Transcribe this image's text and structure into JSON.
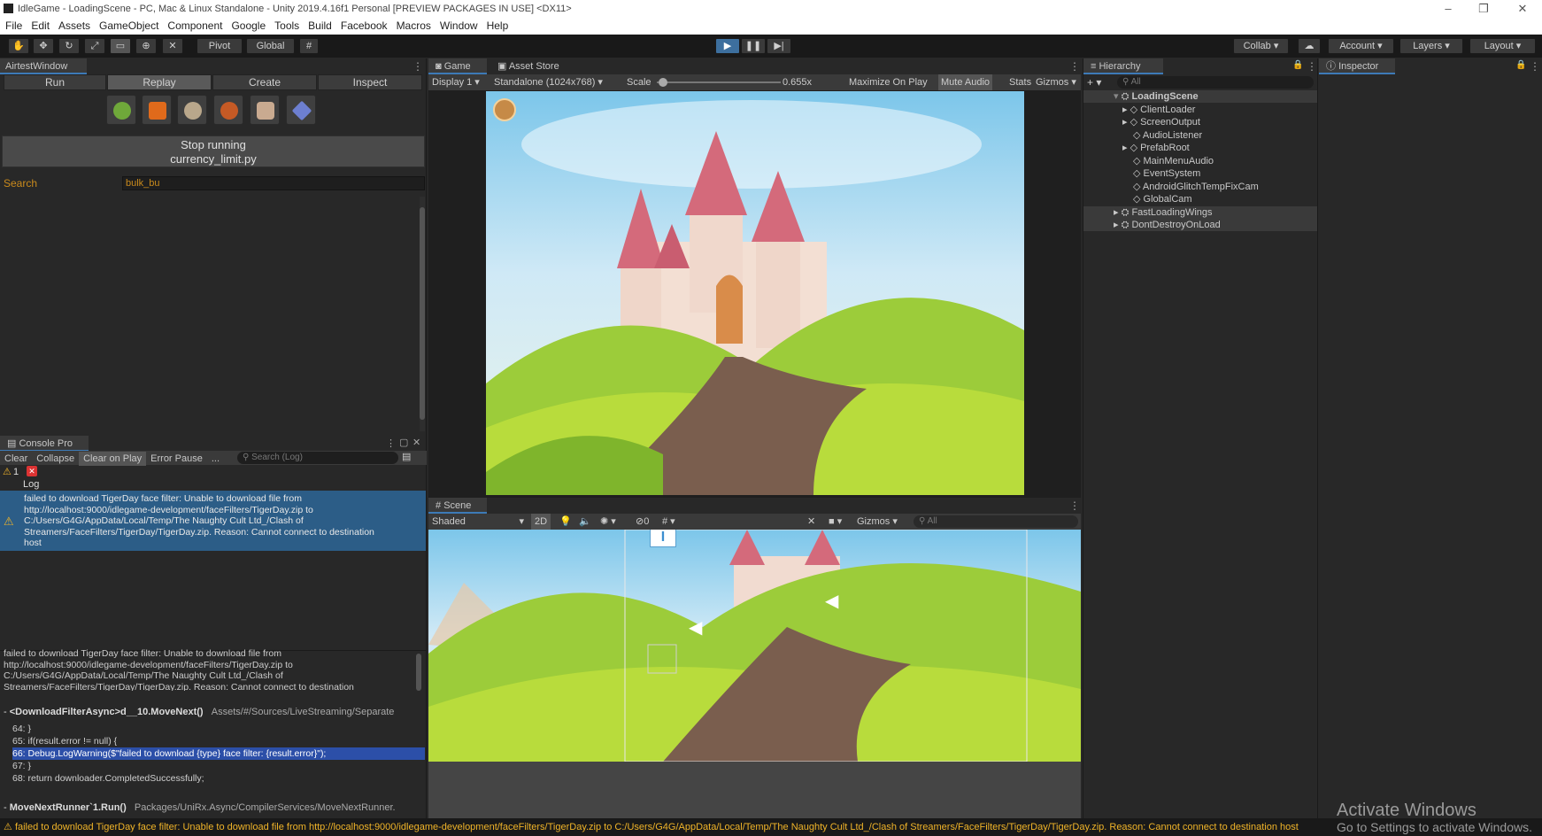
{
  "window": {
    "title": "IdleGame - LoadingScene - PC, Mac & Linux Standalone - Unity 2019.4.16f1 Personal [PREVIEW PACKAGES IN USE] <DX11>"
  },
  "menu": [
    "File",
    "Edit",
    "Assets",
    "GameObject",
    "Component",
    "Google",
    "Tools",
    "Build",
    "Facebook",
    "Macros",
    "Window",
    "Help"
  ],
  "toolbar": {
    "pivot": "Pivot",
    "global": "Global",
    "collab": "Collab",
    "account": "Account",
    "layers": "Layers",
    "layout": "Layout"
  },
  "airtest": {
    "tab": "AirtestWindow",
    "buttons": [
      "Run",
      "Replay",
      "Create",
      "Inspect"
    ],
    "stop_line1": "Stop running",
    "stop_line2": "currency_limit.py",
    "search_label": "Search",
    "search_value": "bulk_bu"
  },
  "game": {
    "tab_game": "Game",
    "tab_store": "Asset Store",
    "display": "Display 1",
    "resolution": "Standalone (1024x768)",
    "scale_label": "Scale",
    "scale_value": "0.655x",
    "maximize": "Maximize On Play",
    "mute": "Mute Audio",
    "stats": "Stats",
    "gizmos": "Gizmos"
  },
  "hierarchy": {
    "tab": "Hierarchy",
    "search_placeholder": "All",
    "scene": "LoadingScene",
    "items": [
      "ClientLoader",
      "ScreenOutput",
      "AudioListener",
      "PrefabRoot",
      "MainMenuAudio",
      "EventSystem",
      "AndroidGlitchTempFixCam",
      "GlobalCam"
    ],
    "other_scenes": [
      "FastLoadingWings",
      "DontDestroyOnLoad"
    ]
  },
  "inspector": {
    "tab": "Inspector"
  },
  "console": {
    "tab": "Console Pro",
    "clear": "Clear",
    "collapse": "Collapse",
    "clear_on_play": "Clear on Play",
    "error_pause": "Error Pause",
    "more": "...",
    "search_placeholder": "Search (Log)",
    "warn_count": "1",
    "log_header": "Log",
    "entry": [
      "failed to download TigerDay face filter: Unable to download file from",
      "http://localhost:9000/idlegame-development/faceFilters/TigerDay.zip to",
      "C:/Users/G4G/AppData/Local/Temp/The Naughty Cult Ltd_/Clash of",
      "Streamers/FaceFilters/TigerDay/TigerDay.zip. Reason: Cannot connect to destination",
      "host"
    ],
    "detail": [
      "failed to download TigerDay face filter: Unable to download file from",
      "http://localhost:9000/idlegame-development/faceFilters/TigerDay.zip to",
      "C:/Users/G4G/AppData/Local/Temp/The Naughty Cult Ltd_/Clash of",
      "Streamers/FaceFilters/TigerDay/TigerDay.zip. Reason: Cannot connect to destination"
    ],
    "stack1_method": "<DownloadFilterAsync>d__10.MoveNext()",
    "stack1_path": "Assets/#/Sources/LiveStreaming/Separate",
    "code": [
      "64:  }",
      "65:  if(result.error != null) {",
      "66:      Debug.LogWarning($\"failed to download {type} face filter: {result.error}\");",
      "67:  }",
      "68:  return downloader.CompletedSuccessfully;"
    ],
    "stack2_method": "MoveNextRunner`1.Run()",
    "stack2_path": "Packages/UniRx.Async/CompilerServices/MoveNextRunner."
  },
  "scene": {
    "tab": "Scene",
    "shading": "Shaded",
    "mode2d": "2D",
    "gizmos": "Gizmos",
    "search_placeholder": "All",
    "hidden_count": "0"
  },
  "status": {
    "message": "failed to download TigerDay face filter: Unable to download file from http://localhost:9000/idlegame-development/faceFilters/TigerDay.zip to C:/Users/G4G/AppData/Local/Temp/The Naughty Cult Ltd_/Clash of Streamers/FaceFilters/TigerDay/TigerDay.zip. Reason: Cannot connect to destination host"
  },
  "watermark": {
    "line1": "Activate Windows",
    "line2": "Go to Settings to activate Windows."
  },
  "colors": {
    "accent": "#2c5d87",
    "warning": "#f0b429",
    "bg": "#282828"
  }
}
